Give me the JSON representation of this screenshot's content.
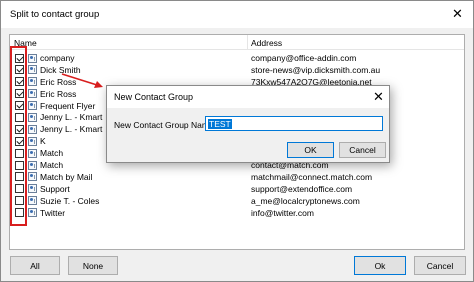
{
  "main_window": {
    "title": "Split to contact group",
    "columns": {
      "name": "Name",
      "address": "Address"
    },
    "rows": [
      {
        "name": "company",
        "address": "company@office-addin.com",
        "checked": true
      },
      {
        "name": "Dick Smith",
        "address": "store-news@vip.dicksmith.com.au",
        "checked": true
      },
      {
        "name": "Eric Ross",
        "address": "73Kxw547A2O7G@leetonia.net",
        "checked": true
      },
      {
        "name": "Eric Ross",
        "address": "",
        "checked": true
      },
      {
        "name": "Frequent Flyer",
        "address": "",
        "checked": true
      },
      {
        "name": "Jenny L. - Kmart",
        "address": "",
        "checked": false
      },
      {
        "name": "Jenny L. - Kmart",
        "address": "",
        "checked": true
      },
      {
        "name": "K",
        "address": "",
        "checked": true
      },
      {
        "name": "Match",
        "address": "",
        "checked": false
      },
      {
        "name": "Match",
        "address": "contact@match.com",
        "checked": false
      },
      {
        "name": "Match by Mail",
        "address": "matchmail@connect.match.com",
        "checked": false
      },
      {
        "name": "Support",
        "address": "support@extendoffice.com",
        "checked": false
      },
      {
        "name": "Suzie T. - Coles",
        "address": "a_me@localcryptonews.com",
        "checked": false
      },
      {
        "name": "Twitter",
        "address": "info@twitter.com",
        "checked": false
      }
    ],
    "buttons": {
      "all": "All",
      "none": "None",
      "ok": "Ok",
      "cancel": "Cancel"
    },
    "close_symbol": "✕"
  },
  "dialog": {
    "title": "New Contact Group",
    "label": "New Contact Group Name:",
    "input_value": "TEST",
    "ok": "OK",
    "cancel": "Cancel",
    "close_symbol": "✕"
  },
  "colors": {
    "highlight_red": "#d81e1e",
    "accent_blue": "#0078d7"
  }
}
